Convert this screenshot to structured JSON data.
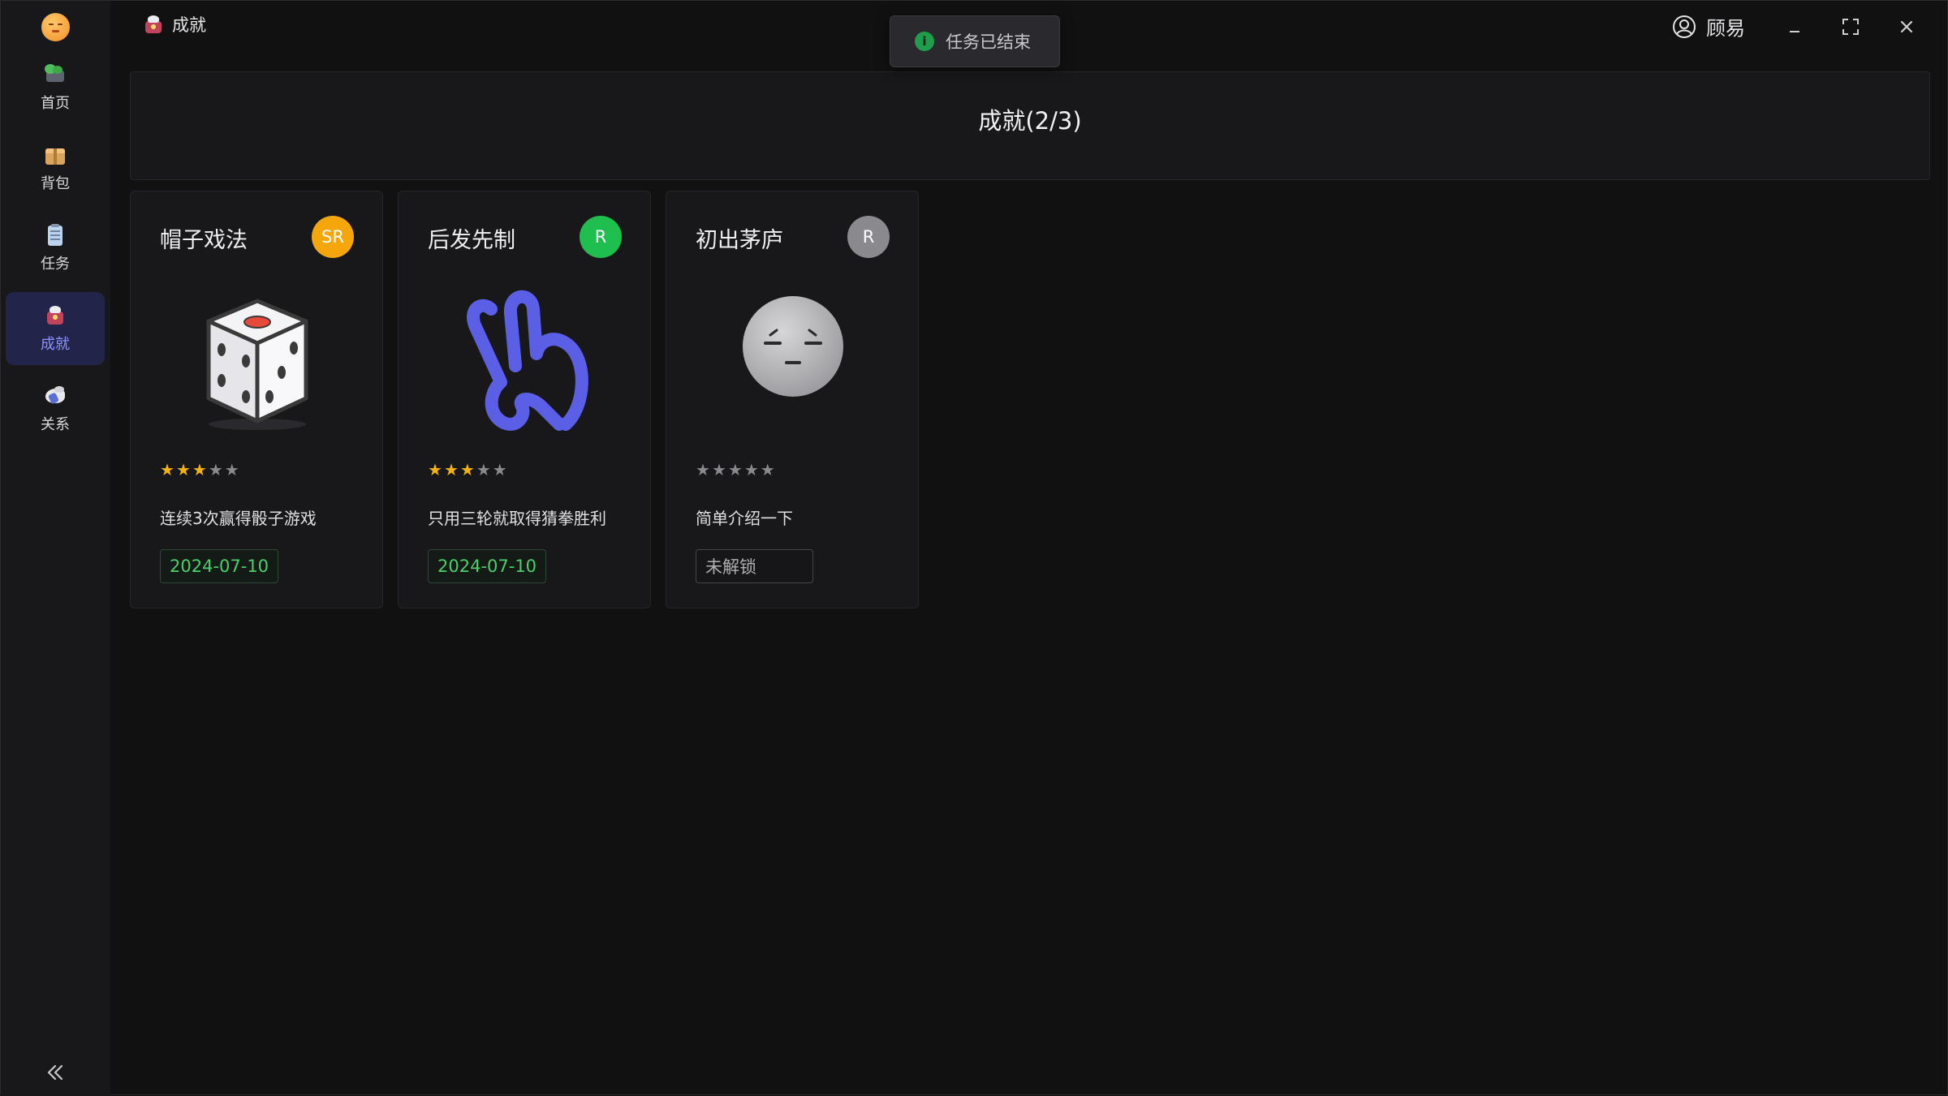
{
  "window": {
    "title": "成就",
    "user_name": "顾易"
  },
  "toast": {
    "message": "任务已结束",
    "icon": "info-circle-icon"
  },
  "sidebar": {
    "items": [
      {
        "label": "首页",
        "icon": "home-icon",
        "active": false
      },
      {
        "label": "背包",
        "icon": "backpack-icon",
        "active": false
      },
      {
        "label": "任务",
        "icon": "clipboard-icon",
        "active": false
      },
      {
        "label": "成就",
        "icon": "achievement-icon",
        "active": true
      },
      {
        "label": "关系",
        "icon": "relationship-icon",
        "active": false
      }
    ],
    "collapse_icon": "double-chevron-left-icon"
  },
  "header": {
    "title": "成就(2/3)"
  },
  "achievements": [
    {
      "name": "帽子戏法",
      "rarity": "SR",
      "rarity_color": "#f5a60b",
      "stars": 3,
      "stars_total": 5,
      "description": "连续3次赢得骰子游戏",
      "status": "2024-07-10",
      "unlocked": true,
      "art_icon": "dice-icon"
    },
    {
      "name": "后发先制",
      "rarity": "R",
      "rarity_color": "#1fbf4f",
      "stars": 3,
      "stars_total": 5,
      "description": "只用三轮就取得猜拳胜利",
      "status": "2024-07-10",
      "unlocked": true,
      "art_icon": "victory-hand-icon"
    },
    {
      "name": "初出茅庐",
      "rarity": "R",
      "rarity_color": "#8a8a8e",
      "stars": 0,
      "stars_total": 5,
      "description": "简单介绍一下",
      "status": "未解锁",
      "unlocked": false,
      "art_icon": "sleepy-face-icon"
    }
  ],
  "colors": {
    "accent": "#8d93ff",
    "active_nav_bg": "#22244a",
    "star_gold": "#f5b30b",
    "star_gray": "#8a8a8e",
    "unlocked_date": "#4ad06a"
  }
}
